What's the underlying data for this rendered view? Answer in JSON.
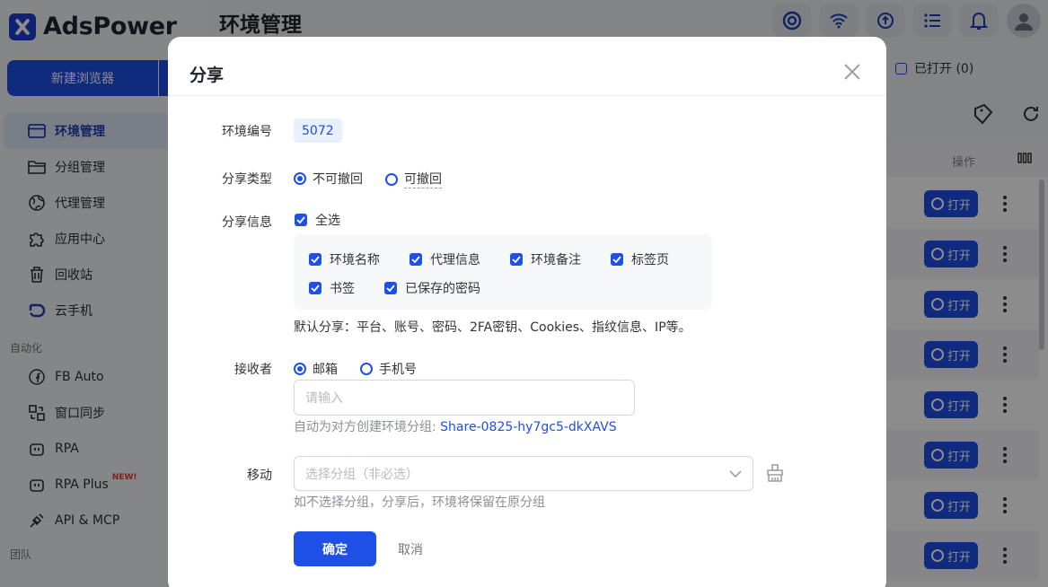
{
  "app": {
    "logo_text": "AdsPower",
    "page_title": "环境管理",
    "new_browser_label": "新建浏览器",
    "opened_label": "已打开 (0)"
  },
  "sidebar": {
    "items": [
      {
        "label": "环境管理",
        "icon": "browser-window-icon",
        "active": true
      },
      {
        "label": "分组管理",
        "icon": "folder-icon"
      },
      {
        "label": "代理管理",
        "icon": "globe-icon"
      },
      {
        "label": "应用中心",
        "icon": "puzzle-icon"
      },
      {
        "label": "回收站",
        "icon": "trash-icon"
      },
      {
        "label": "云手机",
        "icon": "cloud-phone-icon"
      }
    ],
    "section_automation": "自动化",
    "automation_items": [
      {
        "label": "FB Auto",
        "icon": "facebook-icon"
      },
      {
        "label": "窗口同步",
        "icon": "sync-windows-icon"
      },
      {
        "label": "RPA",
        "icon": "robot-icon"
      },
      {
        "label": "RPA Plus",
        "icon": "robot-plus-icon",
        "badge": "NEW!"
      },
      {
        "label": "API & MCP",
        "icon": "api-plug-icon"
      }
    ],
    "section_team": "团队"
  },
  "table": {
    "header_action": "操作",
    "open_button_label": "打开",
    "row_count": 8
  },
  "modal": {
    "title": "分享",
    "env_id_label": "环境编号",
    "env_id_value": "5072",
    "share_type_label": "分享类型",
    "share_type_options": [
      "不可撤回",
      "可撤回"
    ],
    "share_type_selected": "不可撤回",
    "share_info_label": "分享信息",
    "select_all_label": "全选",
    "share_info_options": [
      "环境名称",
      "代理信息",
      "环境备注",
      "标签页",
      "书签",
      "已保存的密码"
    ],
    "default_share_note": "默认分享：平台、账号、密码、2FA密钥、Cookies、指纹信息、IP等。",
    "receiver_label": "接收者",
    "receiver_options": [
      "邮箱",
      "手机号"
    ],
    "receiver_selected": "邮箱",
    "receiver_placeholder": "请输入",
    "auto_group_hint": "自动为对方创建环境分组: ",
    "auto_group_name": "Share-0825-hy7gc5-dkXAVS",
    "move_label": "移动",
    "move_placeholder": "选择分组（非必选）",
    "move_hint": "如不选择分组，分享后，环境将保留在原分组",
    "confirm_label": "确定",
    "cancel_label": "取消"
  },
  "colors": {
    "accent": "#1e4fe6",
    "overlay": "rgba(0,0,0,0.45)"
  }
}
